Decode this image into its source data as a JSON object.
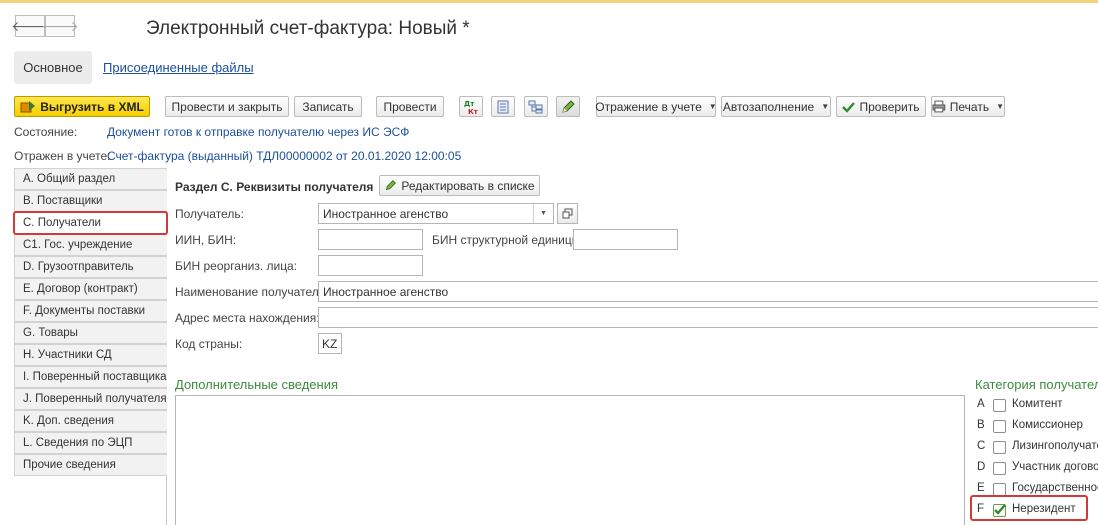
{
  "window": {
    "title": "Электронный счет-фактура: Новый *"
  },
  "nav": {
    "back": "🡐",
    "forward": "🡒"
  },
  "tabs": {
    "main": "Основное",
    "files": "Присоединенные файлы"
  },
  "toolbar": {
    "export_xml": "Выгрузить в XML",
    "post_close": "Провести и закрыть",
    "save": "Записать",
    "post": "Провести",
    "reflect": "Отражение в учете",
    "autofill": "Автозаполнение",
    "check": "Проверить",
    "print": "Печать"
  },
  "status": {
    "state_label": "Состояние:",
    "state_value": "Документ готов к отправке получателю через ИС ЭСФ",
    "reflected_label": "Отражен в учете:",
    "reflected_value": "Счет-фактура (выданный) ТДЛ00000002 от 20.01.2020 12:00:05"
  },
  "sections": [
    "A. Общий раздел",
    "B. Поставщики",
    "C. Получатели",
    "C1. Гос. учреждение",
    "D. Грузоотправитель",
    "E. Договор (контракт)",
    "F. Документы поставки",
    "G. Товары",
    "H. Участники СД",
    "I. Поверенный поставщика",
    "J. Поверенный получателя",
    "K. Доп. сведения",
    "L. Сведения по ЭЦП",
    "Прочие сведения"
  ],
  "form": {
    "section_title": "Раздел С. Реквизиты получателя",
    "edit_in_list": "Редактировать в списке",
    "recipient_label": "Получатель:",
    "recipient_value": "Иностранное агенство",
    "iin_label": "ИИН, БИН:",
    "iin_value": "",
    "bin_struct_label": "БИН структурной единицы:",
    "bin_struct_value": "",
    "bin_reorg_label": "БИН реорганиз. лица:",
    "bin_reorg_value": "",
    "name_label": "Наименование получателя:",
    "name_value": "Иностранное агенство",
    "address_label": "Адрес места нахождения:",
    "address_value": "",
    "country_label": "Код страны:",
    "country_value": "KZ"
  },
  "extra": {
    "title": "Дополнительные сведения"
  },
  "category": {
    "title": "Категория получателя",
    "items": [
      {
        "letter": "A",
        "label": "Комитент",
        "checked": false
      },
      {
        "letter": "B",
        "label": "Комиссионер",
        "checked": false
      },
      {
        "letter": "C",
        "label": "Лизингополучатель",
        "checked": false
      },
      {
        "letter": "D",
        "label": "Участник договора",
        "checked": false
      },
      {
        "letter": "E",
        "label": "Государственное",
        "checked": false
      },
      {
        "letter": "F",
        "label": "Нерезидент",
        "checked": true
      }
    ]
  }
}
